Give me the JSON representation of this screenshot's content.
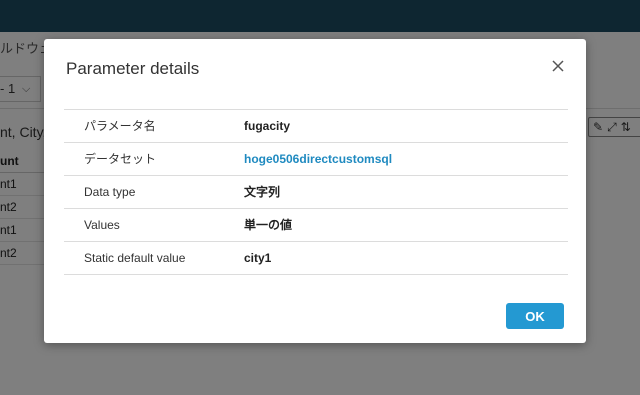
{
  "background": {
    "sheet_title_fragment": "ルドウェ",
    "page_selector": "- 1",
    "fields_fragment": "nt, City,",
    "table": {
      "header": "unt",
      "rows": [
        "nt1",
        "nt2",
        "nt1",
        "nt2"
      ]
    }
  },
  "dialog": {
    "title": "Parameter details",
    "rows": [
      {
        "label": "パラメータ名",
        "value": "fugacity"
      },
      {
        "label": "データセット",
        "value": "hoge0506directcustomsql"
      },
      {
        "label": "Data type",
        "value": "文字列"
      },
      {
        "label": "Values",
        "value": "単一の値"
      },
      {
        "label": "Static default value",
        "value": "city1"
      }
    ],
    "ok_label": "OK"
  },
  "colors": {
    "topbar": "#1d4d63",
    "accent": "#2499d2",
    "link": "#1f8ac0"
  }
}
